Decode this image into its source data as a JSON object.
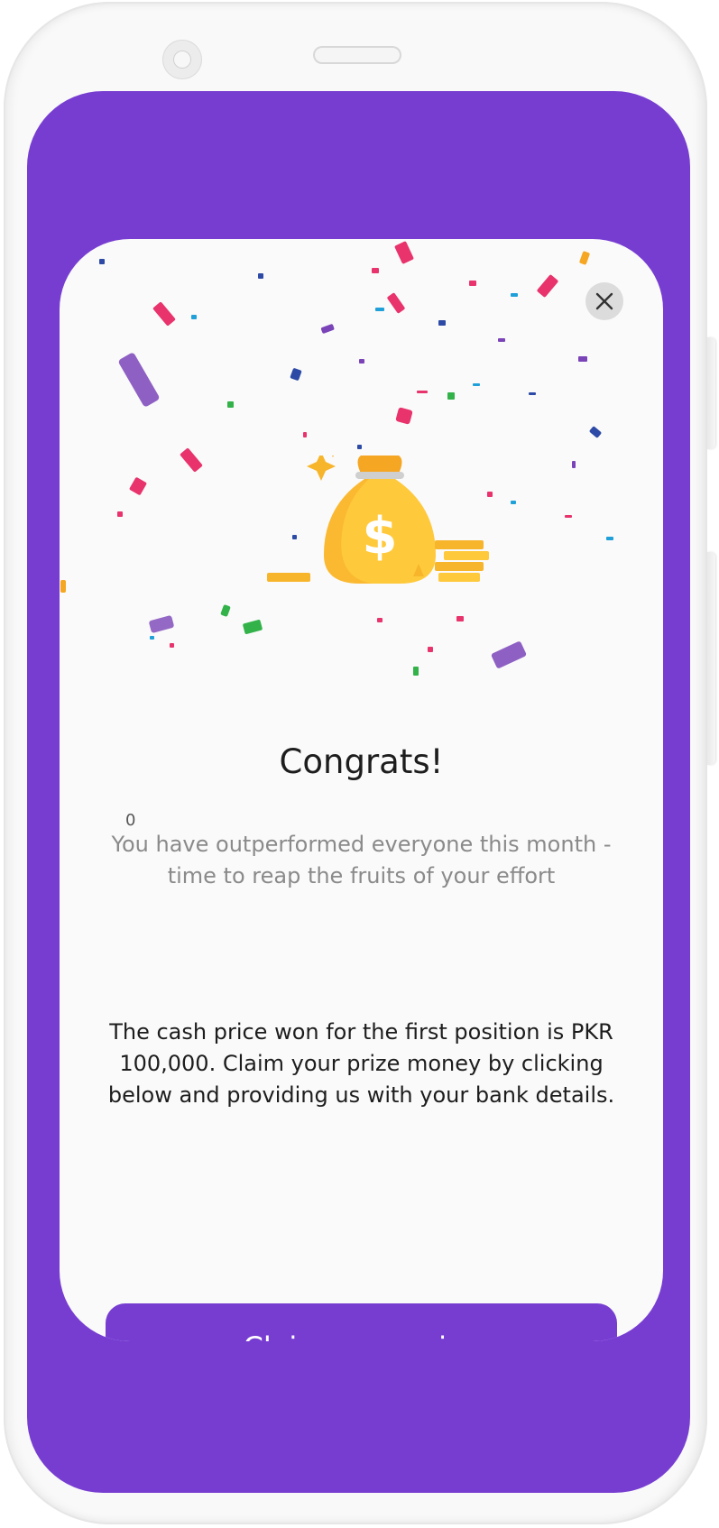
{
  "dialog": {
    "close_icon": "close-icon",
    "illustration_icon": "money-bag-icon",
    "title": "Congrats!",
    "counter": "0",
    "subtitle": "You have outperformed everyone this month - time to reap the fruits of your effort",
    "body": "The cash price won for the first position is PKR 100,000. Claim your prize money by clicking below and providing us with your bank details.",
    "claim_button_label": "Claim your prize"
  },
  "colors": {
    "accent": "#773dd1",
    "card_background": "#fafafa",
    "confetti": [
      "#e8336d",
      "#7a44b8",
      "#2d4aa6",
      "#33b24a",
      "#1fa0d8",
      "#f5a623"
    ]
  }
}
